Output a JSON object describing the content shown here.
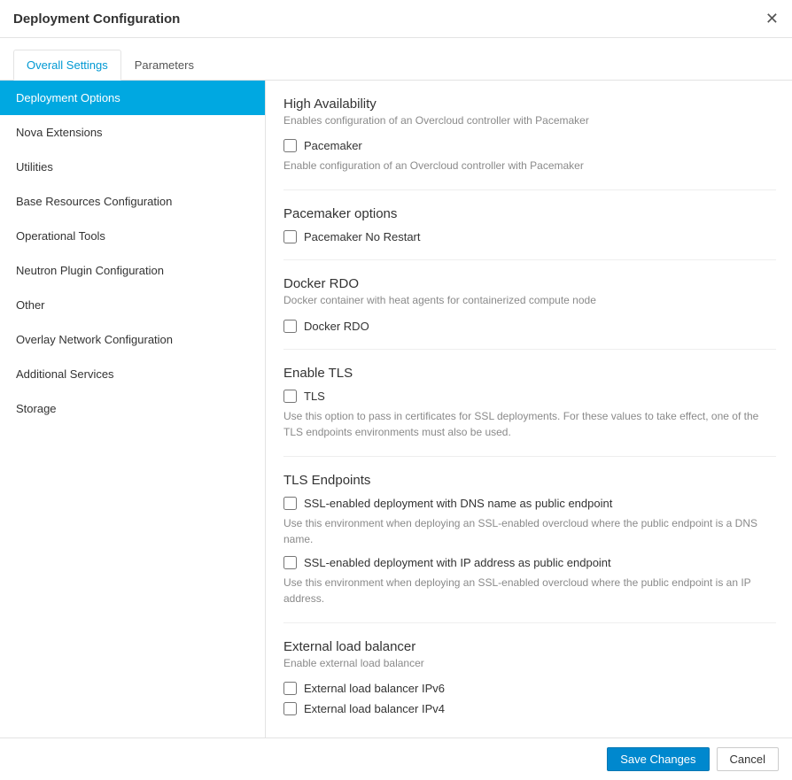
{
  "header": {
    "title": "Deployment Configuration"
  },
  "tabs": {
    "overall": "Overall Settings",
    "parameters": "Parameters"
  },
  "sidebar": {
    "items": [
      "Deployment Options",
      "Nova Extensions",
      "Utilities",
      "Base Resources Configuration",
      "Operational Tools",
      "Neutron Plugin Configuration",
      "Other",
      "Overlay Network Configuration",
      "Additional Services",
      "Storage"
    ]
  },
  "sections": {
    "ha": {
      "title": "High Availability",
      "subtitle": "Enables configuration of an Overcloud controller with Pacemaker",
      "cb1": "Pacemaker",
      "cb1_desc": "Enable configuration of an Overcloud controller with Pacemaker"
    },
    "pacemaker_opts": {
      "title": "Pacemaker options",
      "cb1": "Pacemaker No Restart"
    },
    "docker": {
      "title": "Docker RDO",
      "subtitle": "Docker container with heat agents for containerized compute node",
      "cb1": "Docker RDO"
    },
    "tls": {
      "title": "Enable TLS",
      "cb1": "TLS",
      "cb1_desc": "Use this option to pass in certificates for SSL deployments. For these values to take effect, one of the TLS endpoints environments must also be used."
    },
    "tls_ep": {
      "title": "TLS Endpoints",
      "cb1": "SSL-enabled deployment with DNS name as public endpoint",
      "cb1_desc": "Use this environment when deploying an SSL-enabled overcloud where the public endpoint is a DNS name.",
      "cb2": "SSL-enabled deployment with IP address as public endpoint",
      "cb2_desc": "Use this environment when deploying an SSL-enabled overcloud where the public endpoint is an IP address."
    },
    "elb": {
      "title": "External load balancer",
      "subtitle": "Enable external load balancer",
      "cb1": "External load balancer IPv6",
      "cb2": "External load balancer IPv4"
    }
  },
  "footer": {
    "save": "Save Changes",
    "cancel": "Cancel"
  }
}
